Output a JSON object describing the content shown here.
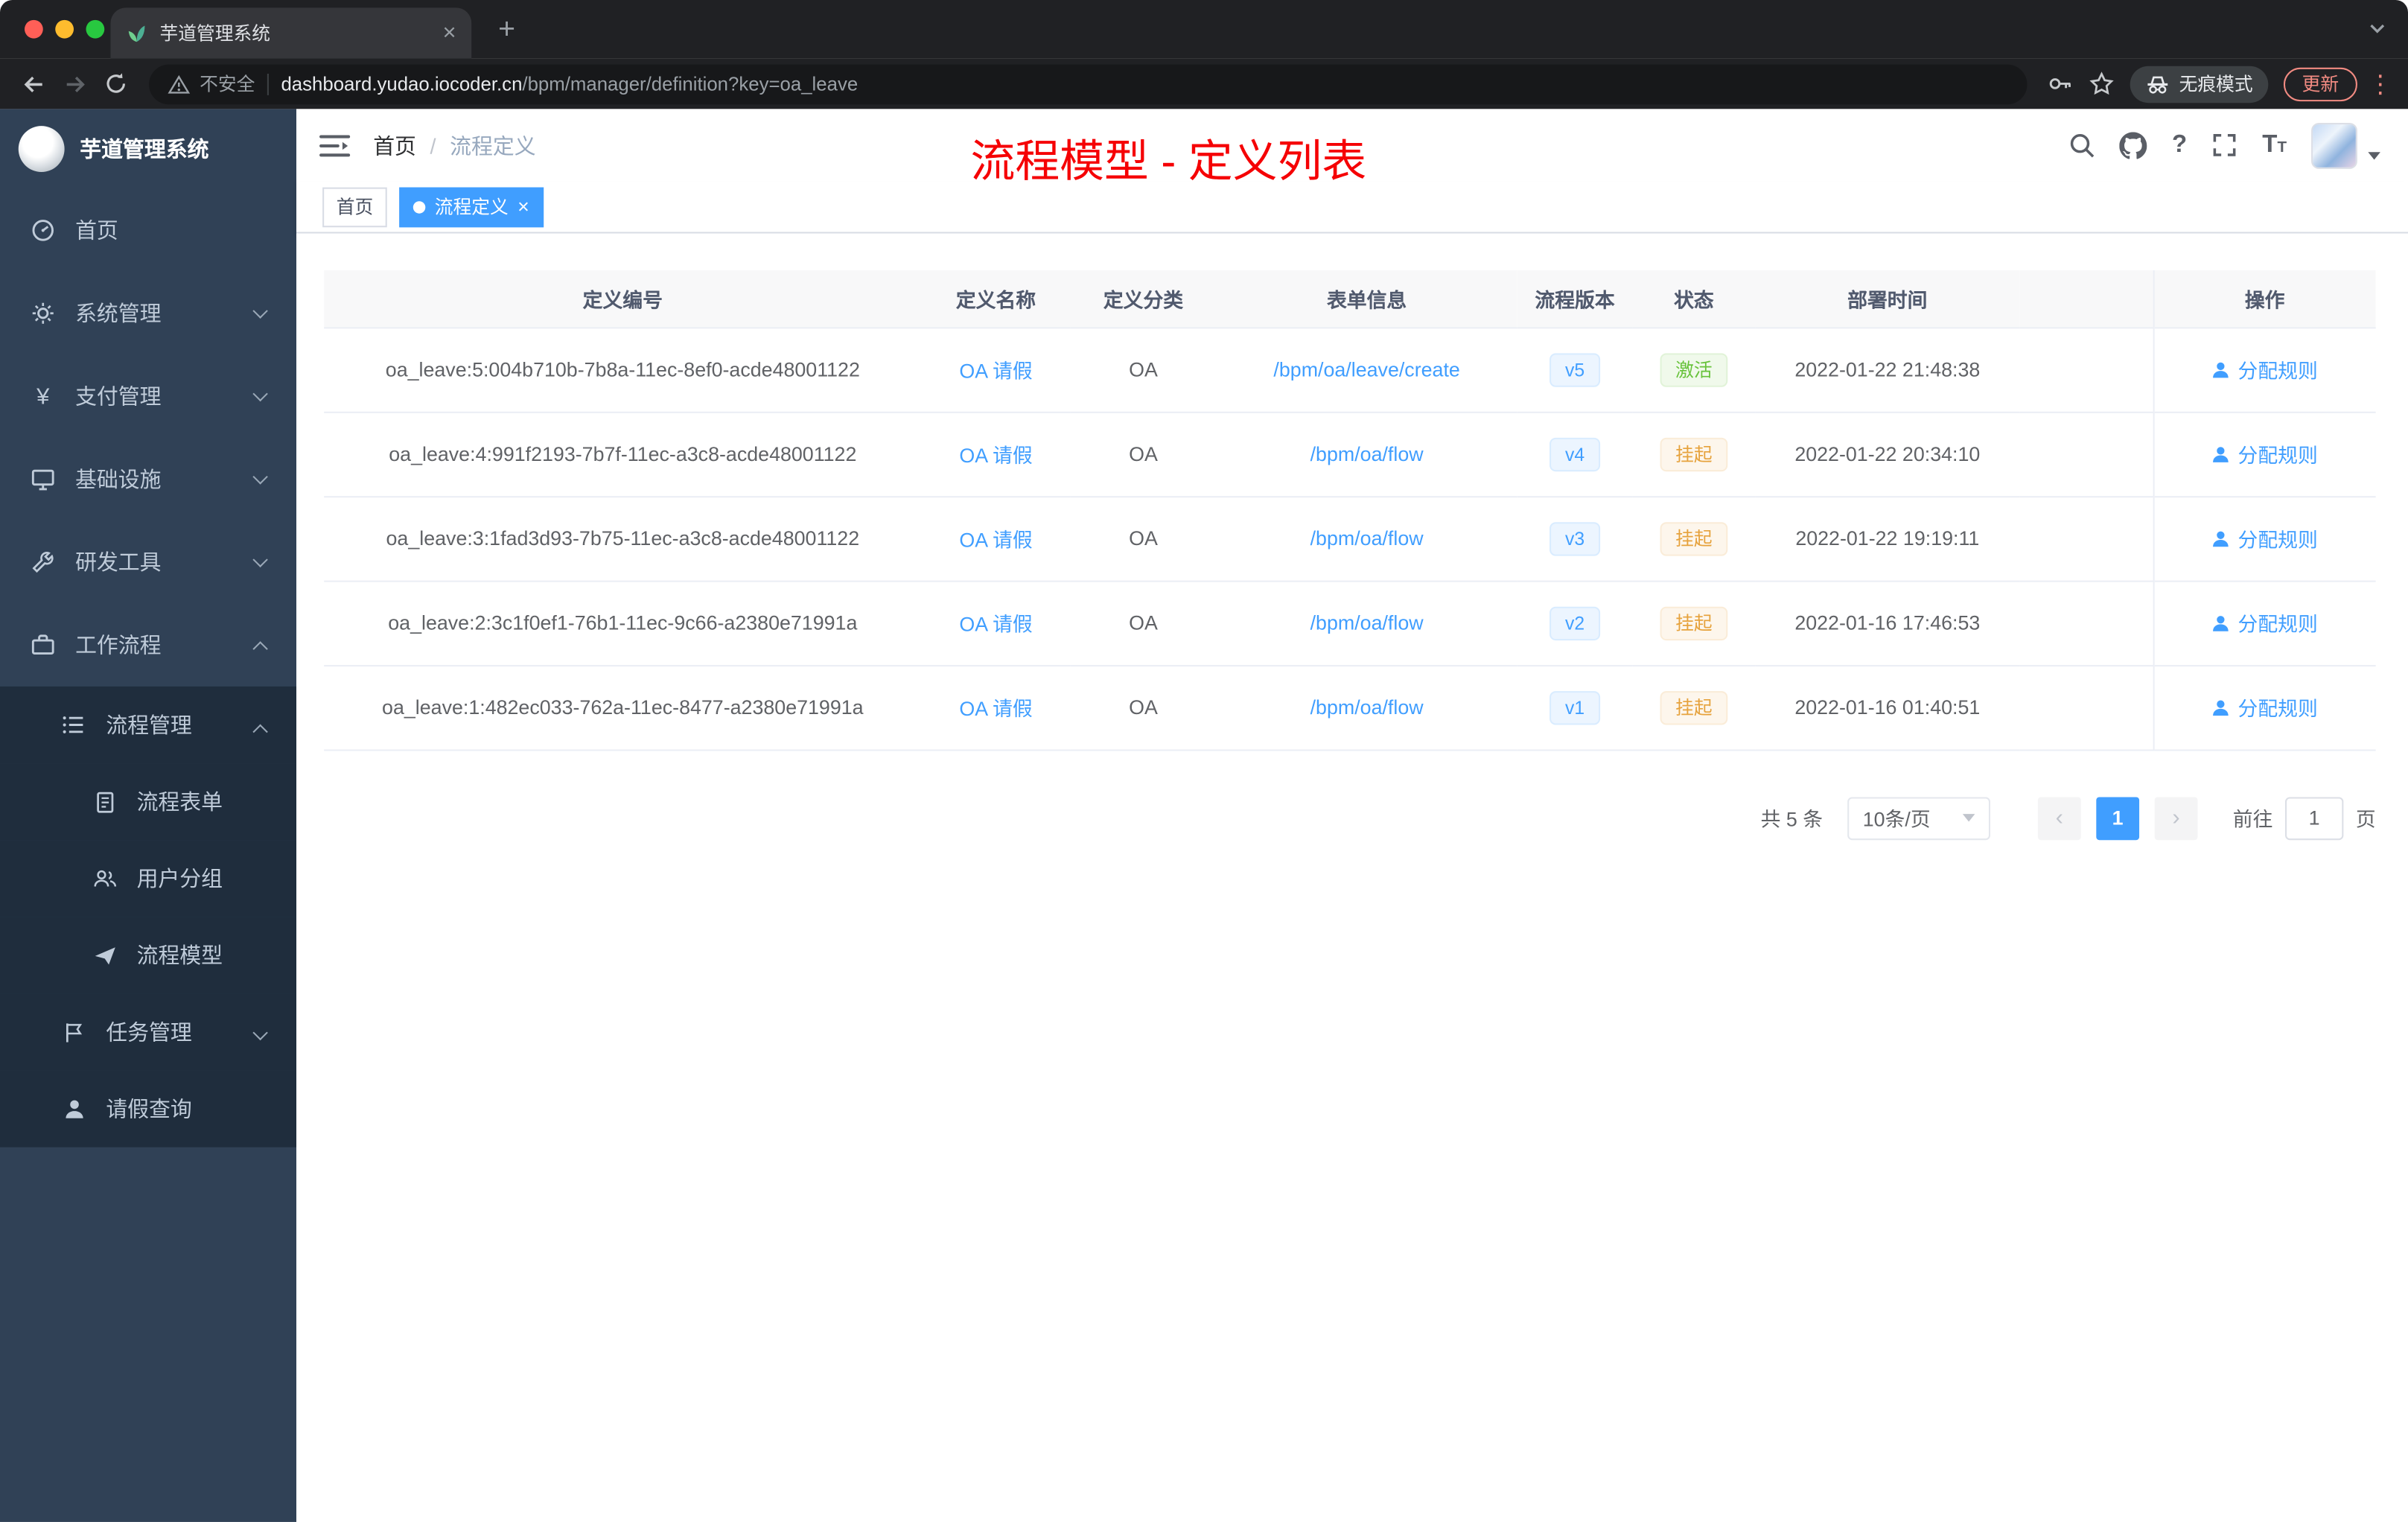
{
  "colors": {
    "accent_blue": "#409eff",
    "success_green": "#67c23a",
    "warning_orange": "#e6a23c",
    "sidebar_bg": "#304156",
    "submenu_bg": "#1f2d3d",
    "annotation_red": "#f50004",
    "chrome_bg": "#202124"
  },
  "browser": {
    "tab_title": "芋道管理系统",
    "security_text": "不安全",
    "url_host": "dashboard.yudao.iocoder.cn",
    "url_path": "/bpm/manager/definition?key=oa_leave",
    "incognito_label": "无痕模式",
    "update_label": "更新"
  },
  "sidebar": {
    "logo_title": "芋道管理系统",
    "items": [
      {
        "label": "首页"
      },
      {
        "label": "系统管理"
      },
      {
        "label": "支付管理"
      },
      {
        "label": "基础设施"
      },
      {
        "label": "研发工具"
      },
      {
        "label": "工作流程"
      },
      {
        "label": "流程管理"
      },
      {
        "label": "流程表单"
      },
      {
        "label": "用户分组"
      },
      {
        "label": "流程模型"
      },
      {
        "label": "任务管理"
      },
      {
        "label": "请假查询"
      }
    ]
  },
  "navbar": {
    "breadcrumb_home": "首页",
    "breadcrumb_separator": "/",
    "breadcrumb_current": "流程定义",
    "annotation": "流程模型 - 定义列表"
  },
  "tags": {
    "home": "首页",
    "active": "流程定义"
  },
  "table": {
    "headers": [
      "定义编号",
      "定义名称",
      "定义分类",
      "表单信息",
      "流程版本",
      "状态",
      "部署时间",
      "操作"
    ],
    "rows": [
      {
        "id": "oa_leave:5:004b710b-7b8a-11ec-8ef0-acde48001122",
        "name": "OA 请假",
        "category": "OA",
        "form": "/bpm/oa/leave/create",
        "version": "v5",
        "status": "激活",
        "deploy_time": "2022-01-22 21:48:38",
        "action": "分配规则"
      },
      {
        "id": "oa_leave:4:991f2193-7b7f-11ec-a3c8-acde48001122",
        "name": "OA 请假",
        "category": "OA",
        "form": "/bpm/oa/flow",
        "version": "v4",
        "status": "挂起",
        "deploy_time": "2022-01-22 20:34:10",
        "action": "分配规则"
      },
      {
        "id": "oa_leave:3:1fad3d93-7b75-11ec-a3c8-acde48001122",
        "name": "OA 请假",
        "category": "OA",
        "form": "/bpm/oa/flow",
        "version": "v3",
        "status": "挂起",
        "deploy_time": "2022-01-22 19:19:11",
        "action": "分配规则"
      },
      {
        "id": "oa_leave:2:3c1f0ef1-76b1-11ec-9c66-a2380e71991a",
        "name": "OA 请假",
        "category": "OA",
        "form": "/bpm/oa/flow",
        "version": "v2",
        "status": "挂起",
        "deploy_time": "2022-01-16 17:46:53",
        "action": "分配规则"
      },
      {
        "id": "oa_leave:1:482ec033-762a-11ec-8477-a2380e71991a",
        "name": "OA 请假",
        "category": "OA",
        "form": "/bpm/oa/flow",
        "version": "v1",
        "status": "挂起",
        "deploy_time": "2022-01-16 01:40:51",
        "action": "分配规则"
      }
    ]
  },
  "pagination": {
    "total": "共 5 条",
    "page_size": "10条/页",
    "current_page": "1",
    "goto_label": "前往",
    "goto_value": "1",
    "page_unit": "页"
  },
  "icons": {
    "tab_close": "×",
    "new_tab": "+",
    "menu_dots": "⋮",
    "question": "?",
    "yen": "¥",
    "prev": "‹",
    "next": "›",
    "tag_close": "×",
    "font_size_big": "T",
    "font_size_small": "T"
  }
}
